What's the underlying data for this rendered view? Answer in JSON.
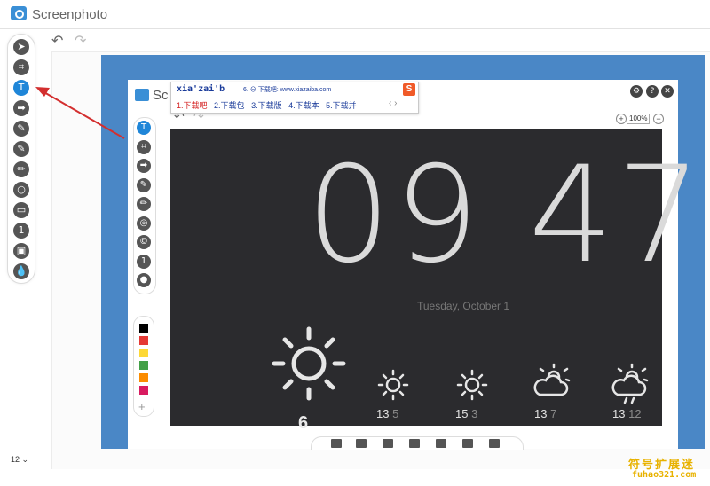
{
  "app": {
    "title": "Screenphoto"
  },
  "toolbar": {
    "size_value": "12"
  },
  "left_tools": [
    {
      "name": "send-icon",
      "glyph": "➤"
    },
    {
      "name": "crop-icon",
      "glyph": "⌗"
    },
    {
      "name": "text-icon",
      "glyph": "T",
      "active": true
    },
    {
      "name": "arrow-icon",
      "glyph": "➡"
    },
    {
      "name": "highlighter-icon",
      "glyph": "✎"
    },
    {
      "name": "marker-icon",
      "glyph": "✎"
    },
    {
      "name": "pencil-icon",
      "glyph": "✏"
    },
    {
      "name": "circle-icon",
      "glyph": "○"
    },
    {
      "name": "rectangle-icon",
      "glyph": "▭"
    },
    {
      "name": "number-icon",
      "glyph": "1"
    },
    {
      "name": "image-icon",
      "glyph": "▣"
    },
    {
      "name": "blur-icon",
      "glyph": "💧"
    }
  ],
  "inner_window": {
    "title": "Sc",
    "zoom": "100%",
    "tools": [
      {
        "name": "text-icon",
        "glyph": "T",
        "active": true
      },
      {
        "name": "crop-icon",
        "glyph": "⌗"
      },
      {
        "name": "arrow-icon",
        "glyph": "➡"
      },
      {
        "name": "highlighter-icon",
        "glyph": "✎"
      },
      {
        "name": "pencil-icon",
        "glyph": "✏"
      },
      {
        "name": "shapes-icon",
        "glyph": "◎"
      },
      {
        "name": "copyright-icon",
        "glyph": "©"
      },
      {
        "name": "number-icon",
        "glyph": "1"
      },
      {
        "name": "blur-icon",
        "glyph": "●"
      }
    ],
    "colors": [
      "#000000",
      "#e53935",
      "#fdd835",
      "#43a047",
      "#fb8c00",
      "#d81b60"
    ],
    "clock": {
      "time": "09 47",
      "date": "Tuesday, October 1",
      "today_temp": "6",
      "forecast": [
        {
          "high": "13",
          "low": "5"
        },
        {
          "high": "15",
          "low": "3"
        },
        {
          "high": "13",
          "low": "7"
        },
        {
          "high": "13",
          "low": "12"
        }
      ]
    }
  },
  "ime": {
    "input": "xia'zai'b",
    "hint": "6. ⊖ 下载吧: www.xiazaiba.com",
    "logo": "S",
    "candidates": [
      "1.下载吧",
      "2.下载包",
      "3.下载版",
      "4.下载本",
      "5.下载并"
    ],
    "nav": "‹ ›"
  },
  "watermark": {
    "line1": "符号扩展迷",
    "line2": "fuhao321.com"
  },
  "colors": {
    "accent": "#1f86d8",
    "frame": "#4a87c6",
    "arrow": "#d32f2f",
    "screen": "#2b2b2e"
  }
}
